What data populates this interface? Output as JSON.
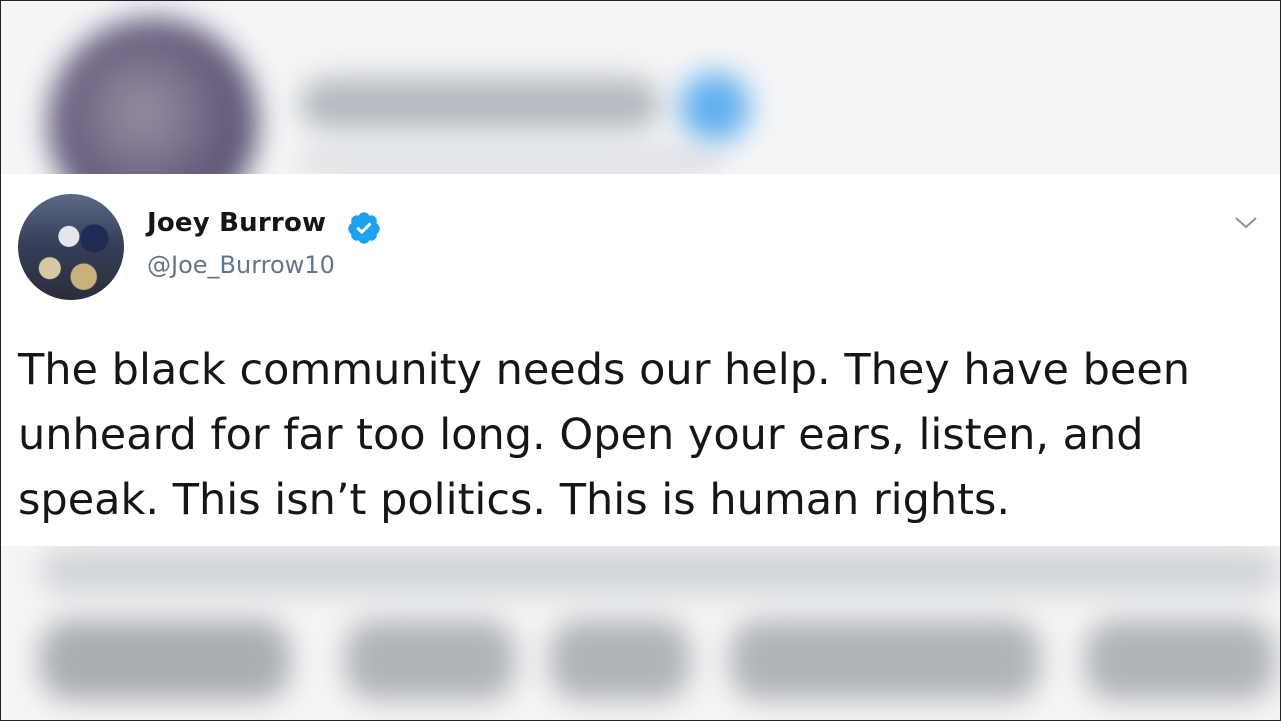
{
  "tweet": {
    "author_name": "Joey Burrow",
    "handle": "@Joe_Burrow10",
    "text": "The black community needs our help. They have been unheard for far too long. Open your ears, listen, and speak. This isn’t politics. This is human rights.",
    "verified": true,
    "icons": {
      "verified": "verified-badge-icon",
      "menu": "chevron-down-icon"
    },
    "colors": {
      "verified_blue": "#1da1f2",
      "text": "#14171a",
      "handle": "#657786"
    }
  }
}
